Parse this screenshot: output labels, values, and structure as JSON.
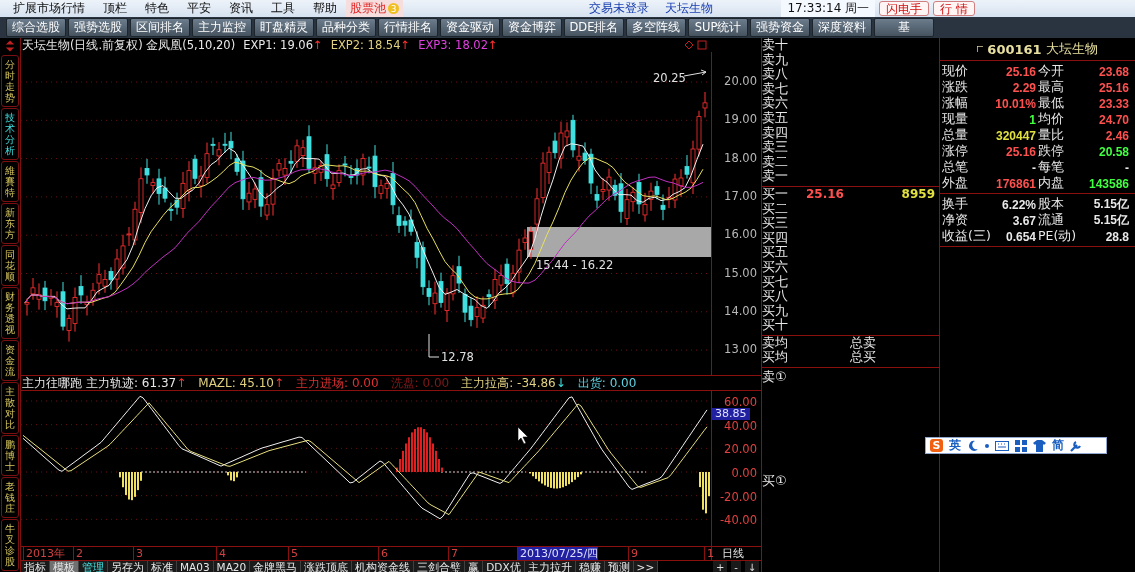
{
  "menu_bar": {
    "items": [
      "扩展市场行情",
      "顶栏",
      "特色",
      "平安",
      "资讯",
      "工具",
      "帮助"
    ],
    "stock_pool": {
      "label": "股票池",
      "badge": "3"
    },
    "trade_status": "交易未登录",
    "stock_name": "天坛生物",
    "clock": "17:33:14 周一",
    "buttons": [
      "闪电手",
      "行 情"
    ]
  },
  "toolbar": {
    "buttons": [
      "综合选股",
      "强势选股",
      "区间排名",
      "主力监控",
      "盯盘精灵",
      "品种分类",
      "行情排名",
      "资金驱动",
      "资金博弈",
      "DDE排名",
      "多空阵线",
      "SUP统计",
      "强势资金",
      "深度资料",
      "基"
    ]
  },
  "side_tabs": [
    {
      "label": "分时走势",
      "selected": false
    },
    {
      "label": "技术分析",
      "selected": true
    },
    {
      "label": "維賽特",
      "selected": false
    },
    {
      "label": "新东方",
      "selected": false
    },
    {
      "label": "同花顺",
      "selected": false
    },
    {
      "label": "财务透视",
      "selected": false
    },
    {
      "label": "资金流",
      "selected": false
    },
    {
      "label": "主散对比",
      "selected": false
    },
    {
      "label": "鹏博士",
      "selected": false
    },
    {
      "label": "老钱庄",
      "selected": false
    },
    {
      "label": "牛叉诊股",
      "selected": false
    }
  ],
  "price_chart": {
    "title": "天坛生物(日线.前复权) 金凤凰(5,10,20)",
    "legend": [
      {
        "label": "EXP1: 19.06",
        "arrow": "↑",
        "color": "#e8e8e8"
      },
      {
        "label": "EXP2: 18.54",
        "arrow": "↑",
        "color": "#e0d080"
      },
      {
        "label": "EXP3: 18.02",
        "arrow": "↑",
        "color": "#e040e0"
      }
    ],
    "axis": [
      "20.00",
      "19.00",
      "18.00",
      "17.00",
      "16.00",
      "15.00",
      "14.00",
      "13.00"
    ],
    "high_label": "20.25",
    "low_label": "12.78",
    "range_label": "15.44 - 16.22"
  },
  "indicator": {
    "legend": [
      {
        "label": "主力往哪跑"
      },
      {
        "label": "主力轨迹: 61.37",
        "arrow": "↑",
        "color": "#e8e8e8"
      },
      {
        "label": "MAZL: 45.10",
        "arrow": "↑",
        "color": "#e0d080"
      },
      {
        "label": "主力进场: 0.00",
        "color": "#e03030"
      },
      {
        "label": "洗盘: 0.00",
        "color": "#801818"
      },
      {
        "label": "主力拉高: -34.86",
        "arrow": "↓",
        "color": "#e0d080"
      },
      {
        "label": "出货: 0.00",
        "color": "#60d0e0"
      }
    ],
    "axis": [
      "60.00",
      "40.00",
      "20.00",
      "0.00",
      "-20.00",
      "-40.00"
    ],
    "current_value": "38.85"
  },
  "date_axis": {
    "labels": [
      {
        "text": "2013年",
        "selected": false
      },
      {
        "text": "2",
        "selected": false
      },
      {
        "text": "3",
        "selected": false
      },
      {
        "text": "4",
        "selected": false
      },
      {
        "text": "5",
        "selected": false
      },
      {
        "text": "6",
        "selected": false
      },
      {
        "text": "7",
        "selected": false
      },
      {
        "text": "2013/07/25/四",
        "selected": true
      },
      {
        "text": "9",
        "selected": false
      },
      {
        "text": "1",
        "selected": false
      }
    ],
    "period": "日线"
  },
  "bottom_tabs": [
    {
      "label": "指标",
      "selected": false,
      "highlighted": false
    },
    {
      "label": "模板",
      "selected": true,
      "highlighted": false
    },
    {
      "label": "管理",
      "selected": false,
      "highlighted": true
    },
    {
      "label": "另存为",
      "selected": false,
      "highlighted": false
    },
    {
      "label": "标准",
      "selected": false,
      "highlighted": false
    },
    {
      "label": "MA03",
      "selected": false,
      "highlighted": false
    },
    {
      "label": "MA20",
      "selected": false,
      "highlighted": false
    },
    {
      "label": "金牌黑马",
      "selected": false,
      "highlighted": false
    },
    {
      "label": "涨跌顶底",
      "selected": false,
      "highlighted": false
    },
    {
      "label": "机构资金线",
      "selected": false,
      "highlighted": false
    },
    {
      "label": "三剑合璧",
      "selected": false,
      "highlighted": false
    },
    {
      "label": "赢",
      "selected": false,
      "highlighted": false
    },
    {
      "label": "DDX优",
      "selected": false,
      "highlighted": false
    },
    {
      "label": "主力拉升",
      "selected": false,
      "highlighted": false
    },
    {
      "label": "稳赚",
      "selected": false,
      "highlighted": false
    },
    {
      "label": "预测",
      "selected": false,
      "highlighted": false
    },
    {
      "label": ">>",
      "selected": false,
      "highlighted": false
    }
  ],
  "zoom_buttons": [
    "+",
    "-",
    "↓"
  ],
  "order_book": {
    "asks": [
      "卖十",
      "卖九",
      "卖八",
      "卖七",
      "卖六",
      "卖五",
      "卖四",
      "卖三",
      "卖二",
      "卖一"
    ],
    "bids": [
      {
        "label": "买一",
        "price": "25.16",
        "volume": "8959"
      },
      {
        "label": "买二"
      },
      {
        "label": "买三"
      },
      {
        "label": "买四"
      },
      {
        "label": "买五"
      },
      {
        "label": "买六"
      },
      {
        "label": "买七"
      },
      {
        "label": "买八"
      },
      {
        "label": "买九"
      },
      {
        "label": "买十"
      }
    ],
    "summary": [
      [
        "卖均",
        "总卖"
      ],
      [
        "买均",
        "总买"
      ]
    ],
    "sell_ticks": "卖①",
    "buy_ticks": "买①"
  },
  "quote": {
    "code": "600161",
    "name": "大坛生物",
    "rows": [
      [
        {
          "label": "现价",
          "value": "25.16",
          "color": "#ff5050"
        },
        {
          "label": "今开",
          "value": "23.68",
          "color": "#ff5050"
        }
      ],
      [
        {
          "label": "涨跌",
          "value": "2.29",
          "color": "#ff5050"
        },
        {
          "label": "最高",
          "value": "25.16",
          "color": "#ff5050"
        }
      ],
      [
        {
          "label": "涨幅",
          "value": "10.01%",
          "color": "#ff5050"
        },
        {
          "label": "最低",
          "value": "23.33",
          "color": "#ff5050"
        }
      ],
      [
        {
          "label": "现量",
          "value": "1",
          "color": "#40ff40"
        },
        {
          "label": "均价",
          "value": "24.70",
          "color": "#ff5050"
        }
      ],
      [
        {
          "label": "总量",
          "value": "320447",
          "color": "#e0e040"
        },
        {
          "label": "量比",
          "value": "2.46",
          "color": "#ff5050"
        }
      ],
      [
        {
          "label": "涨停",
          "value": "25.16",
          "color": "#ff5050"
        },
        {
          "label": "跌停",
          "value": "20.58",
          "color": "#40ff40"
        }
      ],
      [
        {
          "label": "总笔",
          "value": "-"
        },
        {
          "label": "每笔",
          "value": "-"
        }
      ],
      [
        {
          "label": "外盘",
          "value": "176861",
          "color": "#ff5050"
        },
        {
          "label": "内盘",
          "value": "143586",
          "color": "#40ff40"
        }
      ]
    ],
    "rows2": [
      [
        {
          "label": "换手",
          "value": "6.22%",
          "color": "#e8e8e8"
        },
        {
          "label": "股本",
          "value": "5.15亿",
          "color": "#e8e8e8"
        }
      ],
      [
        {
          "label": "净资",
          "value": "3.67",
          "color": "#e8e8e8"
        },
        {
          "label": "流通",
          "value": "5.15亿",
          "color": "#e8e8e8"
        }
      ],
      [
        {
          "label": "收益(三)",
          "value": "0.654",
          "color": "#e8e8e8"
        },
        {
          "label": "PE(动)",
          "value": "28.8",
          "color": "#e8e8e8"
        }
      ]
    ]
  },
  "ime_bar": {
    "logo": "S",
    "mode": "英",
    "charset": "简"
  }
}
